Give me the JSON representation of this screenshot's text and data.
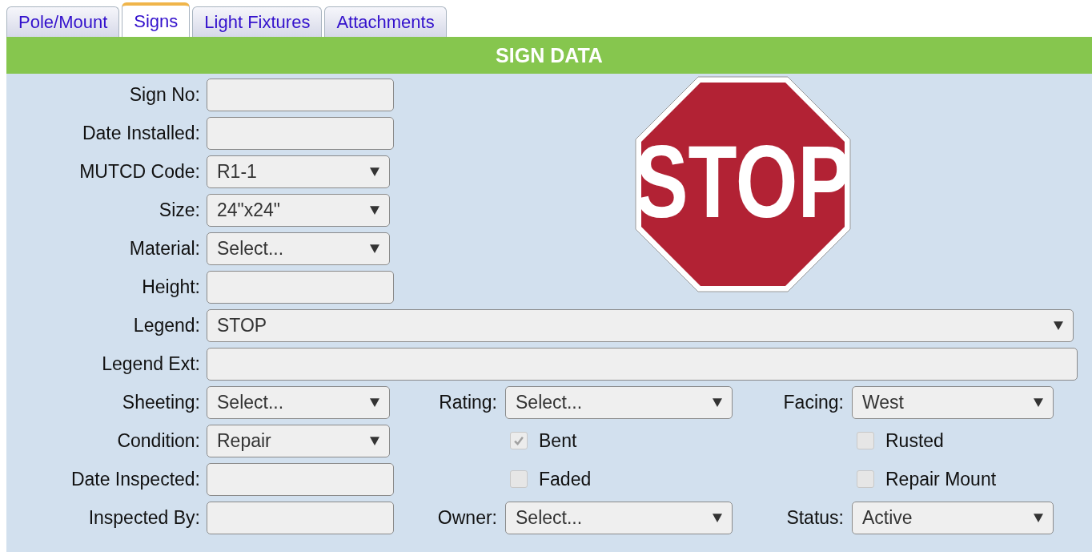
{
  "tabs": [
    {
      "label": "Pole/Mount",
      "selected": false
    },
    {
      "label": "Signs",
      "selected": true
    },
    {
      "label": "Light Fixtures",
      "selected": false
    },
    {
      "label": "Attachments",
      "selected": false
    }
  ],
  "panel": {
    "title": "SIGN DATA"
  },
  "top_fields": [
    {
      "label": "Sign No:",
      "kind": "input"
    },
    {
      "label": "Date Installed:",
      "kind": "input"
    },
    {
      "label": "MUTCD Code:",
      "kind": "select",
      "value": "R1-1"
    },
    {
      "label": "Size:",
      "kind": "select",
      "value": "24\"x24\""
    },
    {
      "label": "Material:",
      "kind": "select",
      "value": "Select..."
    },
    {
      "label": "Height:",
      "kind": "input"
    }
  ],
  "sign_image": {
    "legend": "STOP"
  },
  "wide_fields": [
    {
      "label": "Legend:",
      "kind": "select",
      "value": "STOP"
    },
    {
      "label": "Legend Ext:",
      "kind": "input"
    }
  ],
  "grid_rows": [
    [
      {
        "kind": "select",
        "label": "Sheeting:",
        "value": "Select..."
      },
      {
        "kind": "select",
        "label": "Rating:",
        "value": "Select..."
      },
      {
        "kind": "select",
        "label": "Facing:",
        "value": "West"
      }
    ],
    [
      {
        "kind": "select",
        "label": "Condition:",
        "value": "Repair"
      },
      {
        "kind": "checkbox",
        "label": "Bent",
        "checked": true
      },
      {
        "kind": "checkbox",
        "label": "Rusted",
        "checked": false
      }
    ],
    [
      {
        "kind": "input",
        "label": "Date Inspected:"
      },
      {
        "kind": "checkbox",
        "label": "Faded",
        "checked": false
      },
      {
        "kind": "checkbox",
        "label": "Repair Mount",
        "checked": false
      }
    ],
    [
      {
        "kind": "input",
        "label": "Inspected By:"
      },
      {
        "kind": "select",
        "label": "Owner:",
        "value": "Select..."
      },
      {
        "kind": "select",
        "label": "Status:",
        "value": "Active"
      }
    ]
  ]
}
